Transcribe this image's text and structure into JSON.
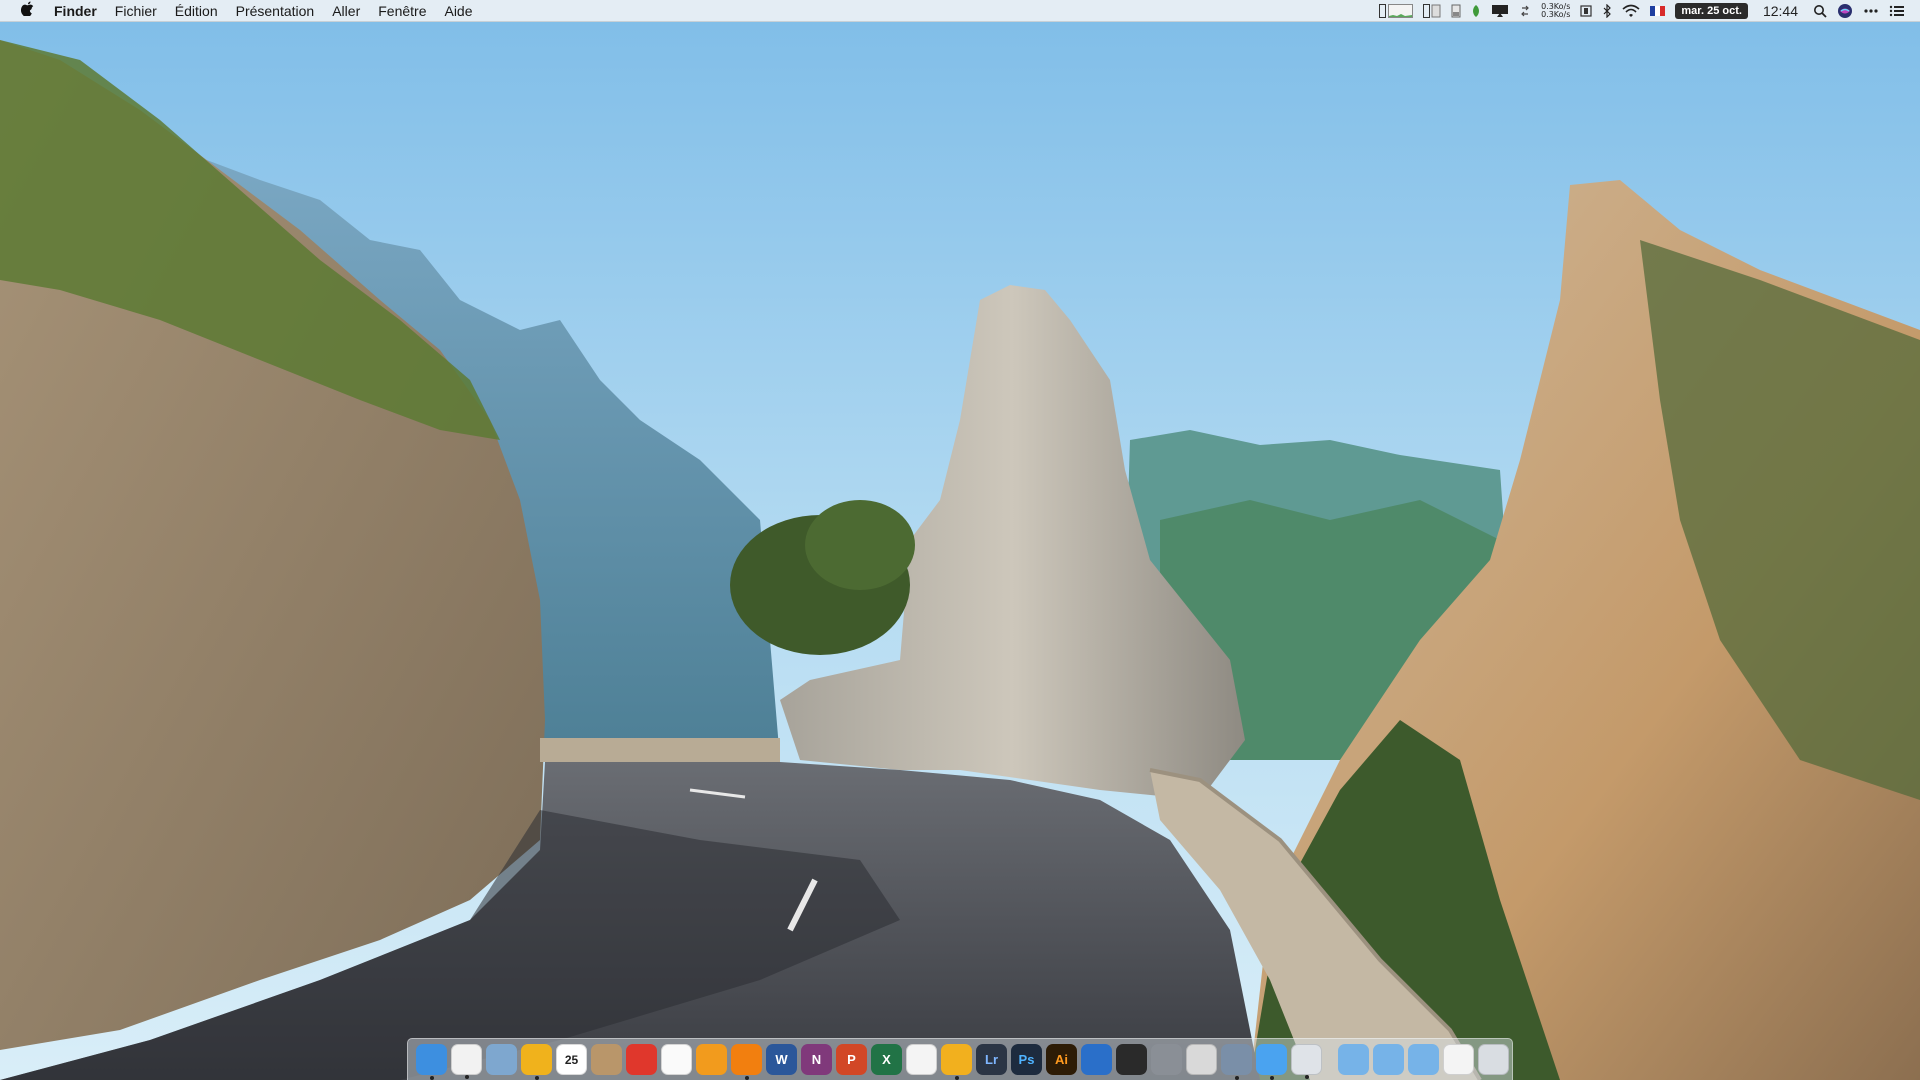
{
  "menubar": {
    "app_name": "Finder",
    "menus": [
      "Fichier",
      "Édition",
      "Présentation",
      "Aller",
      "Fenêtre",
      "Aide"
    ],
    "net_up": "0.3Ko/s",
    "net_down": "0.3Ko/s",
    "date": "mar. 25 oct.",
    "time": "12:44",
    "status_icons": [
      "memory-meter-icon",
      "cpu-meter-icon",
      "disk-meter-icon",
      "battery-leaf-icon",
      "airplay-display-icon",
      "sync-icon",
      "network-speed-meter",
      "sidebar-app-icon",
      "bluetooth-icon",
      "wifi-icon",
      "france-flag-icon",
      "spotlight-icon",
      "siri-icon",
      "more-icon",
      "notification-center-icon"
    ]
  },
  "dock": {
    "apps": [
      {
        "name": "Finder",
        "icon": "finder-icon",
        "label": "",
        "color": "#3d8fe0",
        "running": true
      },
      {
        "name": "Chrome",
        "icon": "chrome-icon",
        "label": "",
        "color": "#f2f2f2",
        "running": true
      },
      {
        "name": "Preview",
        "icon": "preview-icon",
        "label": "",
        "color": "#7ea7cf",
        "running": false
      },
      {
        "name": "Photo Booth",
        "icon": "photobooth-icon",
        "label": "",
        "color": "#f0b21c",
        "running": true
      },
      {
        "name": "Calendar",
        "icon": "calendar-icon",
        "label": "25",
        "color": "#ffffff",
        "running": false
      },
      {
        "name": "Archive Utility",
        "icon": "package-icon",
        "label": "",
        "color": "#b9966a",
        "running": false
      },
      {
        "name": "Bookmarks",
        "icon": "bookmark-star-icon",
        "label": "",
        "color": "#e0372c",
        "running": false
      },
      {
        "name": "iTunes",
        "icon": "itunes-icon",
        "label": "",
        "color": "#fafafa",
        "running": false
      },
      {
        "name": "iBooks",
        "icon": "ibooks-icon",
        "label": "",
        "color": "#f29b1d",
        "running": false
      },
      {
        "name": "VLC",
        "icon": "vlc-icon",
        "label": "",
        "color": "#f27f0f",
        "running": true
      },
      {
        "name": "Word",
        "icon": "word-icon",
        "label": "W",
        "color": "#2b579a",
        "running": false
      },
      {
        "name": "OneNote",
        "icon": "onenote-icon",
        "label": "N",
        "color": "#80397b",
        "running": false
      },
      {
        "name": "PowerPoint",
        "icon": "powerpoint-icon",
        "label": "P",
        "color": "#d24726",
        "running": false
      },
      {
        "name": "Excel",
        "icon": "excel-icon",
        "label": "X",
        "color": "#217346",
        "running": false
      },
      {
        "name": "TextEdit",
        "icon": "textedit-icon",
        "label": "",
        "color": "#f4f4f4",
        "running": false
      },
      {
        "name": "Tes",
        "icon": "butterfly-icon",
        "label": "",
        "color": "#f2b01e",
        "running": true
      },
      {
        "name": "Lightroom",
        "icon": "lightroom-icon",
        "label": "Lr",
        "color": "#2b3545",
        "running": false
      },
      {
        "name": "Photoshop",
        "icon": "photoshop-icon",
        "label": "Ps",
        "color": "#1d2b3e",
        "running": false
      },
      {
        "name": "Illustrator",
        "icon": "illustrator-icon",
        "label": "Ai",
        "color": "#2d1c06",
        "running": false
      },
      {
        "name": "1Password",
        "icon": "onepassword-icon",
        "label": "",
        "color": "#2a6fc9",
        "running": false
      },
      {
        "name": "Terminal",
        "icon": "terminal-icon",
        "label": "",
        "color": "#2a2a2a",
        "running": false
      },
      {
        "name": "System Preferences",
        "icon": "system-preferences-icon",
        "label": "",
        "color": "#8a8f96",
        "running": false
      },
      {
        "name": "Photos Viewer",
        "icon": "photos-viewer-icon",
        "label": "",
        "color": "#d9d9d9",
        "running": false
      },
      {
        "name": "Scanner",
        "icon": "scanner-icon",
        "label": "",
        "color": "#7a8fa8",
        "running": true
      },
      {
        "name": "Messages",
        "icon": "messages-icon",
        "label": "",
        "color": "#4aa3f0",
        "running": true
      },
      {
        "name": "Script Editor",
        "icon": "script-icon",
        "label": "",
        "color": "#dfe3e8",
        "running": true
      }
    ],
    "stacks": [
      {
        "name": "Applications",
        "icon": "applications-folder-icon",
        "color": "#76b3e8"
      },
      {
        "name": "Downloads",
        "icon": "downloads-folder-icon",
        "color": "#76b3e8"
      },
      {
        "name": "Documents",
        "icon": "documents-folder-icon",
        "color": "#76b3e8"
      },
      {
        "name": "Chrome Document",
        "icon": "chrome-document-icon",
        "color": "#f4f4f4"
      },
      {
        "name": "Trash",
        "icon": "trash-icon",
        "color": "#d9dde2"
      }
    ]
  },
  "colors": {
    "sky_top": "#7fbde8",
    "sky_bottom": "#cfe8f6",
    "rock": "#b7aa94",
    "road": "#4a4d54"
  }
}
